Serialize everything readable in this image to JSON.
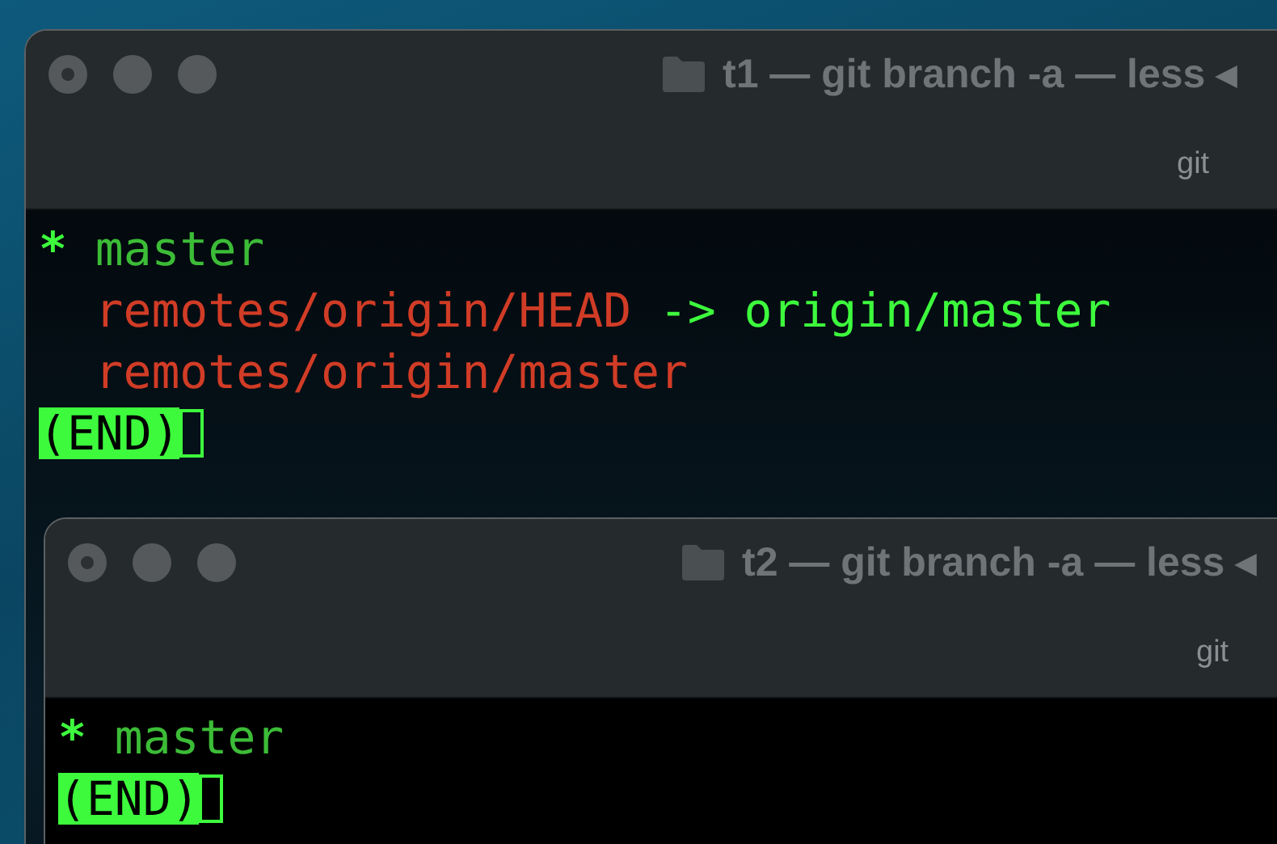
{
  "windows": [
    {
      "title": "t1 — git branch -a — less ◂",
      "tab": "git",
      "lines": [
        {
          "indented": false,
          "segments": [
            {
              "text": "*",
              "kind": "marker"
            },
            {
              "text": "master",
              "kind": "current"
            }
          ]
        },
        {
          "indented": true,
          "segments": [
            {
              "text": "remotes/origin/HEAD",
              "kind": "remote"
            },
            {
              "text": "->",
              "kind": "pointer"
            },
            {
              "text": "origin/master",
              "kind": "pointer"
            }
          ]
        },
        {
          "indented": true,
          "segments": [
            {
              "text": "remotes/origin/master",
              "kind": "remote"
            }
          ]
        }
      ],
      "prompt": "(END)"
    },
    {
      "title": "t2 — git branch -a — less ◂",
      "tab": "git",
      "lines": [
        {
          "indented": false,
          "segments": [
            {
              "text": "*",
              "kind": "marker"
            },
            {
              "text": "master",
              "kind": "current"
            }
          ]
        }
      ],
      "prompt": "(END)"
    }
  ]
}
